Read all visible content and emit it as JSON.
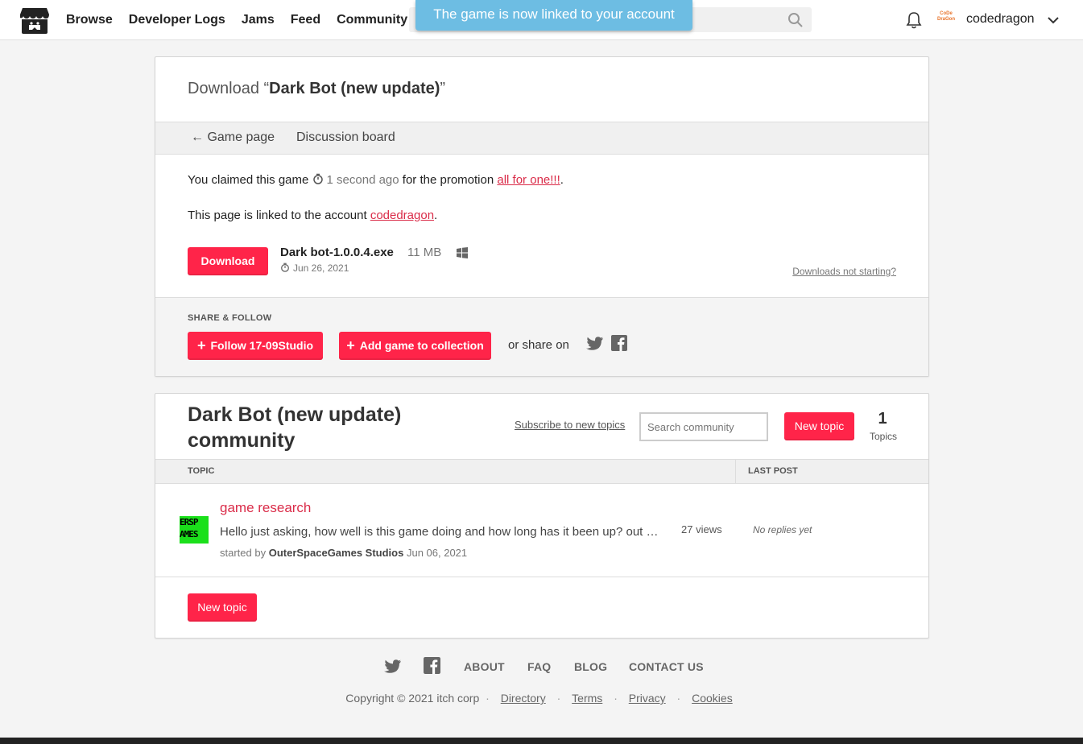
{
  "header": {
    "nav": [
      "Browse",
      "Developer Logs",
      "Jams",
      "Feed",
      "Community"
    ],
    "toast": "The game is now linked to your account",
    "avatar_text": "CoDe DraGon",
    "username": "codedragon"
  },
  "download": {
    "title_prefix": "Download “",
    "title_game": "Dark Bot (new update)",
    "title_suffix": "”",
    "back_link": "← Game page",
    "discussion_link": "Discussion board",
    "claim_text": "You claimed this game",
    "claim_time": "1 second ago",
    "claim_for": "for the promotion",
    "promotion": "all for one!!!",
    "linked_text": "This page is linked to the account",
    "linked_account": "codedragon",
    "download_button": "Download",
    "file_name": "Dark bot-1.0.0.4.exe",
    "file_size": "11 MB",
    "file_date": "Jun 26, 2021",
    "help_link": "Downloads not starting?",
    "share_label": "SHARE & FOLLOW",
    "follow_button": "Follow 17-09Studio",
    "collection_button": "Add game to collection",
    "share_on": "or share on"
  },
  "community": {
    "title": "Dark Bot (new update) community",
    "subscribe": "Subscribe to new topics",
    "search_placeholder": "Search community",
    "new_topic": "New topic",
    "topic_count": "1",
    "topic_count_label": "Topics",
    "col_topic": "TOPIC",
    "col_last_post": "LAST POST",
    "topics": [
      {
        "avatar_text": "ERSP AMES",
        "title": "game research",
        "excerpt": "Hello just asking, how well is this game doing and how long has it been up? out of curiosity",
        "started_by_label": "started by",
        "author": "OuterSpaceGames Studios",
        "date": "Jun 06, 2021",
        "views": "27 views",
        "last_post": "No replies yet"
      }
    ]
  },
  "footer": {
    "links": [
      "ABOUT",
      "FAQ",
      "BLOG",
      "CONTACT US"
    ],
    "copyright": "Copyright © 2021 itch corp",
    "sub_links": [
      "Directory",
      "Terms",
      "Privacy",
      "Cookies"
    ]
  },
  "colors": {
    "accent": "#ff2449",
    "link": "#da2c49",
    "toast": "#6dbde3"
  }
}
